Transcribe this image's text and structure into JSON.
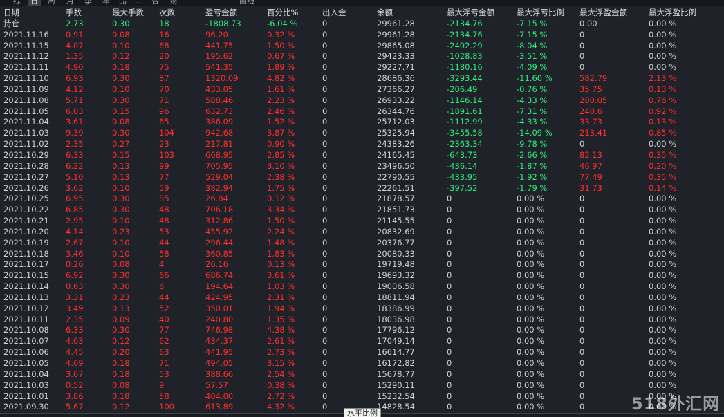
{
  "top_tabs": [
    "综",
    "日",
    "周",
    "月",
    "季",
    "年",
    "品",
    "…",
    "合",
    "财",
    "曲线"
  ],
  "columns": [
    "日期",
    "手数",
    "最大手数",
    "次数",
    "盈亏金额",
    "百分比%",
    "出入金",
    "余额",
    "最大浮亏金额",
    "最大浮亏比例",
    "最大浮盈金额",
    "最大浮盈比例"
  ],
  "colors": {
    "positive": "#ff2e2e",
    "negative": "#2dee7a",
    "neutral": "#d0d0d0"
  },
  "rows": [
    {
      "date": "持仓",
      "lots": "2.73",
      "max_lots": "0.30",
      "count": "18",
      "pnl": "-1808.73",
      "pct": "-6.04 %",
      "flow": "0",
      "balance": "29961.28",
      "max_dd": "-2134.76",
      "max_dd_pct": "-7.15 %",
      "max_fp": "0.00",
      "max_fp_pct": "0.00 %",
      "tone": "green",
      "fp_tone": "white"
    },
    {
      "date": "2021.11.16",
      "lots": "0.91",
      "max_lots": "0.08",
      "count": "16",
      "pnl": "96.20",
      "pct": "0.32 %",
      "flow": "0",
      "balance": "29961.28",
      "max_dd": "-2134.76",
      "max_dd_pct": "-7.15 %",
      "max_fp": "0",
      "max_fp_pct": "0.00 %",
      "tone": "red",
      "fp_tone": "white"
    },
    {
      "date": "2021.11.15",
      "lots": "4.07",
      "max_lots": "0.10",
      "count": "68",
      "pnl": "441.75",
      "pct": "1.50 %",
      "flow": "0",
      "balance": "29865.08",
      "max_dd": "-2402.29",
      "max_dd_pct": "-8.04 %",
      "max_fp": "0",
      "max_fp_pct": "0.00 %",
      "tone": "red",
      "fp_tone": "white"
    },
    {
      "date": "2021.11.12",
      "lots": "1.35",
      "max_lots": "0.12",
      "count": "20",
      "pnl": "195.62",
      "pct": "0.67 %",
      "flow": "0",
      "balance": "29423.33",
      "max_dd": "-1028.83",
      "max_dd_pct": "-3.51 %",
      "max_fp": "0",
      "max_fp_pct": "0.00 %",
      "tone": "red",
      "fp_tone": "white"
    },
    {
      "date": "2021.11.11",
      "lots": "4.90",
      "max_lots": "0.18",
      "count": "75",
      "pnl": "541.35",
      "pct": "1.89 %",
      "flow": "0",
      "balance": "29227.71",
      "max_dd": "-1180.16",
      "max_dd_pct": "-4.09 %",
      "max_fp": "0",
      "max_fp_pct": "0.00 %",
      "tone": "red",
      "fp_tone": "white"
    },
    {
      "date": "2021.11.10",
      "lots": "6.93",
      "max_lots": "0.30",
      "count": "87",
      "pnl": "1320.09",
      "pct": "4.82 %",
      "flow": "0",
      "balance": "28686.36",
      "max_dd": "-3293.44",
      "max_dd_pct": "-11.60 %",
      "max_fp": "582.79",
      "max_fp_pct": "2.13 %",
      "tone": "red",
      "fp_tone": "red"
    },
    {
      "date": "2021.11.09",
      "lots": "4.12",
      "max_lots": "0.10",
      "count": "70",
      "pnl": "433.05",
      "pct": "1.61 %",
      "flow": "0",
      "balance": "27366.27",
      "max_dd": "-206.49",
      "max_dd_pct": "-0.76 %",
      "max_fp": "35.75",
      "max_fp_pct": "0.13 %",
      "tone": "red",
      "fp_tone": "red"
    },
    {
      "date": "2021.11.08",
      "lots": "5.71",
      "max_lots": "0.30",
      "count": "71",
      "pnl": "588.46",
      "pct": "2.23 %",
      "flow": "0",
      "balance": "26933.22",
      "max_dd": "-1146.14",
      "max_dd_pct": "-4.33 %",
      "max_fp": "200.05",
      "max_fp_pct": "0.76 %",
      "tone": "red",
      "fp_tone": "red"
    },
    {
      "date": "2021.11.05",
      "lots": "6.03",
      "max_lots": "0.15",
      "count": "96",
      "pnl": "632.73",
      "pct": "2.46 %",
      "flow": "0",
      "balance": "26344.76",
      "max_dd": "-1891.61",
      "max_dd_pct": "-7.31 %",
      "max_fp": "240.6",
      "max_fp_pct": "0.92 %",
      "tone": "red",
      "fp_tone": "red"
    },
    {
      "date": "2021.11.04",
      "lots": "3.61",
      "max_lots": "0.08",
      "count": "65",
      "pnl": "386.09",
      "pct": "1.52 %",
      "flow": "0",
      "balance": "25712.03",
      "max_dd": "-1112.99",
      "max_dd_pct": "-4.33 %",
      "max_fp": "33.73",
      "max_fp_pct": "0.13 %",
      "tone": "red",
      "fp_tone": "red"
    },
    {
      "date": "2021.11.03",
      "lots": "9.39",
      "max_lots": "0.30",
      "count": "104",
      "pnl": "942.68",
      "pct": "3.87 %",
      "flow": "0",
      "balance": "25325.94",
      "max_dd": "-3455.58",
      "max_dd_pct": "-14.09 %",
      "max_fp": "213.41",
      "max_fp_pct": "0.85 %",
      "tone": "red",
      "fp_tone": "red"
    },
    {
      "date": "2021.11.02",
      "lots": "2.35",
      "max_lots": "0.27",
      "count": "23",
      "pnl": "217.81",
      "pct": "0.90 %",
      "flow": "0",
      "balance": "24383.26",
      "max_dd": "-2363.34",
      "max_dd_pct": "-9.78 %",
      "max_fp": "0",
      "max_fp_pct": "0.00 %",
      "tone": "red",
      "fp_tone": "white"
    },
    {
      "date": "2021.10.29",
      "lots": "6.33",
      "max_lots": "0.15",
      "count": "103",
      "pnl": "668.95",
      "pct": "2.85 %",
      "flow": "0",
      "balance": "24165.45",
      "max_dd": "-643.73",
      "max_dd_pct": "-2.66 %",
      "max_fp": "82.13",
      "max_fp_pct": "0.35 %",
      "tone": "red",
      "fp_tone": "red"
    },
    {
      "date": "2021.10.28",
      "lots": "6.22",
      "max_lots": "0.13",
      "count": "99",
      "pnl": "705.95",
      "pct": "3.10 %",
      "flow": "0",
      "balance": "23496.50",
      "max_dd": "-436.14",
      "max_dd_pct": "-1.87 %",
      "max_fp": "46.97",
      "max_fp_pct": "0.20 %",
      "tone": "red",
      "fp_tone": "red"
    },
    {
      "date": "2021.10.27",
      "lots": "5.10",
      "max_lots": "0.13",
      "count": "77",
      "pnl": "529.04",
      "pct": "2.38 %",
      "flow": "0",
      "balance": "22790.55",
      "max_dd": "-433.95",
      "max_dd_pct": "-1.92 %",
      "max_fp": "77.49",
      "max_fp_pct": "0.35 %",
      "tone": "red",
      "fp_tone": "red"
    },
    {
      "date": "2021.10.26",
      "lots": "3.62",
      "max_lots": "0.10",
      "count": "59",
      "pnl": "382.94",
      "pct": "1.75 %",
      "flow": "0",
      "balance": "22261.51",
      "max_dd": "-397.52",
      "max_dd_pct": "-1.79 %",
      "max_fp": "31.73",
      "max_fp_pct": "0.14 %",
      "tone": "red",
      "fp_tone": "red"
    },
    {
      "date": "2021.10.25",
      "lots": "6.95",
      "max_lots": "0.30",
      "count": "85",
      "pnl": "26.84",
      "pct": "0.12 %",
      "flow": "0",
      "balance": "21878.57",
      "max_dd": "0",
      "max_dd_pct": "0.00 %",
      "max_fp": "0",
      "max_fp_pct": "0.00 %",
      "tone": "red",
      "fp_tone": "white",
      "dd_tone": "white"
    },
    {
      "date": "2021.10.22",
      "lots": "6.85",
      "max_lots": "0.30",
      "count": "48",
      "pnl": "706.18",
      "pct": "3.34 %",
      "flow": "0",
      "balance": "21851.73",
      "max_dd": "0",
      "max_dd_pct": "0.00 %",
      "max_fp": "0",
      "max_fp_pct": "0.00 %",
      "tone": "red",
      "fp_tone": "white",
      "dd_tone": "white"
    },
    {
      "date": "2021.10.21",
      "lots": "2.95",
      "max_lots": "0.10",
      "count": "48",
      "pnl": "312.86",
      "pct": "1.50 %",
      "flow": "0",
      "balance": "21145.55",
      "max_dd": "0",
      "max_dd_pct": "0.00 %",
      "max_fp": "0",
      "max_fp_pct": "0.00 %",
      "tone": "red",
      "fp_tone": "white",
      "dd_tone": "white"
    },
    {
      "date": "2021.10.20",
      "lots": "4.14",
      "max_lots": "0.23",
      "count": "53",
      "pnl": "455.92",
      "pct": "2.24 %",
      "flow": "0",
      "balance": "20832.69",
      "max_dd": "0",
      "max_dd_pct": "0.00 %",
      "max_fp": "0",
      "max_fp_pct": "0.00 %",
      "tone": "red",
      "fp_tone": "white",
      "dd_tone": "white"
    },
    {
      "date": "2021.10.19",
      "lots": "2.67",
      "max_lots": "0.10",
      "count": "44",
      "pnl": "296.44",
      "pct": "1.48 %",
      "flow": "0",
      "balance": "20376.77",
      "max_dd": "0",
      "max_dd_pct": "0.00 %",
      "max_fp": "0",
      "max_fp_pct": "0.00 %",
      "tone": "red",
      "fp_tone": "white",
      "dd_tone": "white"
    },
    {
      "date": "2021.10.18",
      "lots": "3.46",
      "max_lots": "0.10",
      "count": "58",
      "pnl": "360.85",
      "pct": "1.83 %",
      "flow": "0",
      "balance": "20080.33",
      "max_dd": "0",
      "max_dd_pct": "0.00 %",
      "max_fp": "0",
      "max_fp_pct": "0.00 %",
      "tone": "red",
      "fp_tone": "white",
      "dd_tone": "white"
    },
    {
      "date": "2021.10.17",
      "lots": "0.26",
      "max_lots": "0.08",
      "count": "4",
      "pnl": "26.16",
      "pct": "0.13 %",
      "flow": "0",
      "balance": "19719.48",
      "max_dd": "0",
      "max_dd_pct": "0.00 %",
      "max_fp": "0",
      "max_fp_pct": "0.00 %",
      "tone": "red",
      "fp_tone": "white",
      "dd_tone": "white"
    },
    {
      "date": "2021.10.15",
      "lots": "6.92",
      "max_lots": "0.30",
      "count": "66",
      "pnl": "686.74",
      "pct": "3.61 %",
      "flow": "0",
      "balance": "19693.32",
      "max_dd": "0",
      "max_dd_pct": "0.00 %",
      "max_fp": "0",
      "max_fp_pct": "0.00 %",
      "tone": "red",
      "fp_tone": "white",
      "dd_tone": "white"
    },
    {
      "date": "2021.10.14",
      "lots": "0.63",
      "max_lots": "0.30",
      "count": "6",
      "pnl": "194.64",
      "pct": "1.03 %",
      "flow": "0",
      "balance": "19006.58",
      "max_dd": "0",
      "max_dd_pct": "0.00 %",
      "max_fp": "0",
      "max_fp_pct": "0.00 %",
      "tone": "red",
      "fp_tone": "white",
      "dd_tone": "white"
    },
    {
      "date": "2021.10.13",
      "lots": "3.31",
      "max_lots": "0.23",
      "count": "44",
      "pnl": "424.95",
      "pct": "2.31 %",
      "flow": "0",
      "balance": "18811.94",
      "max_dd": "0",
      "max_dd_pct": "0.00 %",
      "max_fp": "0",
      "max_fp_pct": "0.00 %",
      "tone": "red",
      "fp_tone": "white",
      "dd_tone": "white"
    },
    {
      "date": "2021.10.12",
      "lots": "3.49",
      "max_lots": "0.13",
      "count": "52",
      "pnl": "350.01",
      "pct": "1.94 %",
      "flow": "0",
      "balance": "18386.99",
      "max_dd": "0",
      "max_dd_pct": "0.00 %",
      "max_fp": "0",
      "max_fp_pct": "0.00 %",
      "tone": "red",
      "fp_tone": "white",
      "dd_tone": "white"
    },
    {
      "date": "2021.10.11",
      "lots": "2.35",
      "max_lots": "0.09",
      "count": "40",
      "pnl": "240.80",
      "pct": "1.35 %",
      "flow": "0",
      "balance": "18036.98",
      "max_dd": "0",
      "max_dd_pct": "0.00 %",
      "max_fp": "0",
      "max_fp_pct": "0.00 %",
      "tone": "red",
      "fp_tone": "white",
      "dd_tone": "white"
    },
    {
      "date": "2021.10.08",
      "lots": "6.33",
      "max_lots": "0.30",
      "count": "77",
      "pnl": "746.98",
      "pct": "4.38 %",
      "flow": "0",
      "balance": "17796.12",
      "max_dd": "0",
      "max_dd_pct": "0.00 %",
      "max_fp": "0",
      "max_fp_pct": "0.00 %",
      "tone": "red",
      "fp_tone": "white",
      "dd_tone": "white"
    },
    {
      "date": "2021.10.07",
      "lots": "4.03",
      "max_lots": "0.12",
      "count": "62",
      "pnl": "434.37",
      "pct": "2.61 %",
      "flow": "0",
      "balance": "17049.14",
      "max_dd": "0",
      "max_dd_pct": "0.00 %",
      "max_fp": "0",
      "max_fp_pct": "0.00 %",
      "tone": "red",
      "fp_tone": "white",
      "dd_tone": "white"
    },
    {
      "date": "2021.10.06",
      "lots": "4.45",
      "max_lots": "0.20",
      "count": "63",
      "pnl": "441.95",
      "pct": "2.73 %",
      "flow": "0",
      "balance": "16614.77",
      "max_dd": "0",
      "max_dd_pct": "0.00 %",
      "max_fp": "0",
      "max_fp_pct": "0.00 %",
      "tone": "red",
      "fp_tone": "white",
      "dd_tone": "white"
    },
    {
      "date": "2021.10.05",
      "lots": "4.69",
      "max_lots": "0.18",
      "count": "71",
      "pnl": "494.05",
      "pct": "3.15 %",
      "flow": "0",
      "balance": "16172.82",
      "max_dd": "0",
      "max_dd_pct": "0.00 %",
      "max_fp": "0",
      "max_fp_pct": "0.00 %",
      "tone": "red",
      "fp_tone": "white",
      "dd_tone": "white"
    },
    {
      "date": "2021.10.04",
      "lots": "3.67",
      "max_lots": "0.18",
      "count": "53",
      "pnl": "388.66",
      "pct": "2.54 %",
      "flow": "0",
      "balance": "15678.77",
      "max_dd": "0",
      "max_dd_pct": "0.00 %",
      "max_fp": "0",
      "max_fp_pct": "0.00 %",
      "tone": "red",
      "fp_tone": "white",
      "dd_tone": "white"
    },
    {
      "date": "2021.10.03",
      "lots": "0.52",
      "max_lots": "0.08",
      "count": "9",
      "pnl": "57.57",
      "pct": "0.38 %",
      "flow": "0",
      "balance": "15290.11",
      "max_dd": "0",
      "max_dd_pct": "0.00 %",
      "max_fp": "0",
      "max_fp_pct": "0.00 %",
      "tone": "red",
      "fp_tone": "white",
      "dd_tone": "white"
    },
    {
      "date": "2021.10.01",
      "lots": "3.86",
      "max_lots": "0.18",
      "count": "58",
      "pnl": "404.00",
      "pct": "2.72 %",
      "flow": "0",
      "balance": "15232.54",
      "max_dd": "0",
      "max_dd_pct": "0.00 %",
      "max_fp": "0",
      "max_fp_pct": "0.00 %",
      "tone": "red",
      "fp_tone": "white",
      "dd_tone": "white"
    },
    {
      "date": "2021.09.30",
      "lots": "5.67",
      "max_lots": "0.12",
      "count": "100",
      "pnl": "613.89",
      "pct": "4.32 %",
      "flow": "0",
      "balance": "14828.54",
      "max_dd": "0",
      "max_dd_pct": "0.00 %",
      "max_fp": "0",
      "max_fp_pct": "0.00 %",
      "tone": "red",
      "fp_tone": "white",
      "dd_tone": "white"
    }
  ],
  "tooltip": "水平比例",
  "watermark": "518外汇网"
}
